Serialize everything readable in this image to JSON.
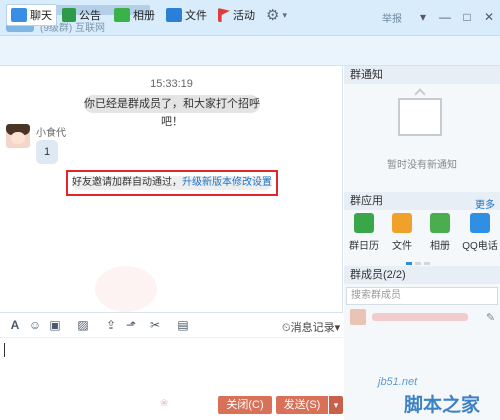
{
  "window": {
    "title_sub": "(9级群) 互联网",
    "report": "举报",
    "controls": {
      "dropdown": "▾",
      "minimize": "—",
      "maximize": "□",
      "close": "✕"
    }
  },
  "tabs": [
    {
      "label": "聊天",
      "icon": "chat-icon",
      "color": "#3a8ee6"
    },
    {
      "label": "公告",
      "icon": "announcement-icon",
      "color": "#2d9b4a"
    },
    {
      "label": "相册",
      "icon": "photo-album-icon",
      "color": "#3bb14a"
    },
    {
      "label": "文件",
      "icon": "folder-icon",
      "color": "#2b7fd6"
    },
    {
      "label": "活动",
      "icon": "flag-icon",
      "color": "#e23b3b"
    }
  ],
  "settings_icon": "gear-icon",
  "chat": {
    "timestamp": "15:33:19",
    "system_message": "你已经是群成员了，和大家打个招呼吧！",
    "sender": "小食代",
    "message": "1",
    "notice_text": "好友邀请加群自动通过，",
    "notice_link": "升级新版本修改设置"
  },
  "toolbar": {
    "font_icon": "A",
    "emoji_icon": "☺",
    "history_label": "消息记录",
    "history_arrow": "▾"
  },
  "actions": {
    "close_label": "关闭(C)",
    "send_label": "发送(S)",
    "send_dropdown": "▾"
  },
  "right_panel": {
    "notice_header": "群通知",
    "no_notice": "暂时没有新通知",
    "apps_header": "群应用",
    "more": "更多",
    "apps": [
      {
        "label": "群日历",
        "color": "#3aa64a"
      },
      {
        "label": "文件",
        "color": "#f0a12c"
      },
      {
        "label": "相册",
        "color": "#4aae4f"
      },
      {
        "label": "QQ电话",
        "color": "#2f8fe3"
      }
    ],
    "members_header": "群成员(2/2)",
    "search_placeholder": "搜索群成员"
  },
  "watermark": {
    "site": "jb51.net",
    "brand": "脚本之家"
  }
}
